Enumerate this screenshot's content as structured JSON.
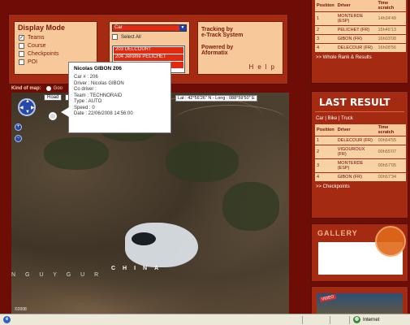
{
  "display_mode": {
    "title": "Display Mode",
    "options": [
      {
        "label": "Teams",
        "checked": true
      },
      {
        "label": "Course",
        "checked": false
      },
      {
        "label": "Checkpoints",
        "checked": false
      },
      {
        "label": "POI",
        "checked": false
      }
    ]
  },
  "selector": {
    "dropdown_value": "Car",
    "select_all_label": "Select All",
    "list_items": [
      "203 DELCOURT",
      "204 Jerome PELICHET",
      "",
      ""
    ]
  },
  "tracking": {
    "line1": "Tracking by",
    "line2": "e-Track System",
    "line3": "Powered by",
    "line4": "Aformatix",
    "help": "Help"
  },
  "map": {
    "kind_label": "Kind of map:",
    "kind_option": "Goo",
    "road_button": "Road",
    "a_button": "A",
    "latlon": "Lat : 42°56'26\" N - Long : 088°59'50\" E",
    "china_label": "CHINA",
    "uygur_label": "N G U Y G U R",
    "copyright": "©2008",
    "zoom_in": "+",
    "zoom_out": "−"
  },
  "popup": {
    "title": "Nicolas GIBON 206",
    "lines": [
      "Car # : 206",
      "Driver : Nicolas GIBON",
      "Co driver :",
      "Team : TECHNORAID",
      "Type : AUTO",
      "Speed : 0",
      "Date : 22/06/2008 14:56:00"
    ]
  },
  "whole_rank": {
    "headers": [
      "Position",
      "Driver",
      "Time scratch"
    ],
    "rows": [
      {
        "pos": "1",
        "driver": "MONTERDE (ESP)",
        "time": "14h34'49"
      },
      {
        "pos": "2",
        "driver": "PELICHET (FR)",
        "time": "15h46'13"
      },
      {
        "pos": "3",
        "driver": "GIBON (FR)",
        "time": "16h03'08"
      },
      {
        "pos": "4",
        "driver": "DELECOUR (FR)",
        "time": "16h08'56"
      }
    ],
    "link": ">> Whole Rank & Results"
  },
  "last_result": {
    "title": "LAST RESULT",
    "filter": "Car | Bike | Truck",
    "headers": [
      "Position",
      "Driver",
      "Time scratch"
    ],
    "rows": [
      {
        "pos": "1",
        "driver": "DELECOUR (FR)",
        "time": "00h54'55"
      },
      {
        "pos": "2",
        "driver": "VIGOUROUX (FR)",
        "time": "00h55'07"
      },
      {
        "pos": "3",
        "driver": "MONTERDE (ESP)",
        "time": "00h57'05"
      },
      {
        "pos": "4",
        "driver": "GIBON (FR)",
        "time": "00h57'34"
      }
    ],
    "link": ">> Checkpoints"
  },
  "gallery": {
    "title": "GALLERY"
  },
  "video": {
    "badge": "VIDEO"
  },
  "statusbar": {
    "zone": "Internet"
  },
  "colors": {
    "brand_dark": "#6e0d06",
    "brand": "#a52a12",
    "panel": "#f7c99a",
    "accent_red": "#e02a12"
  }
}
